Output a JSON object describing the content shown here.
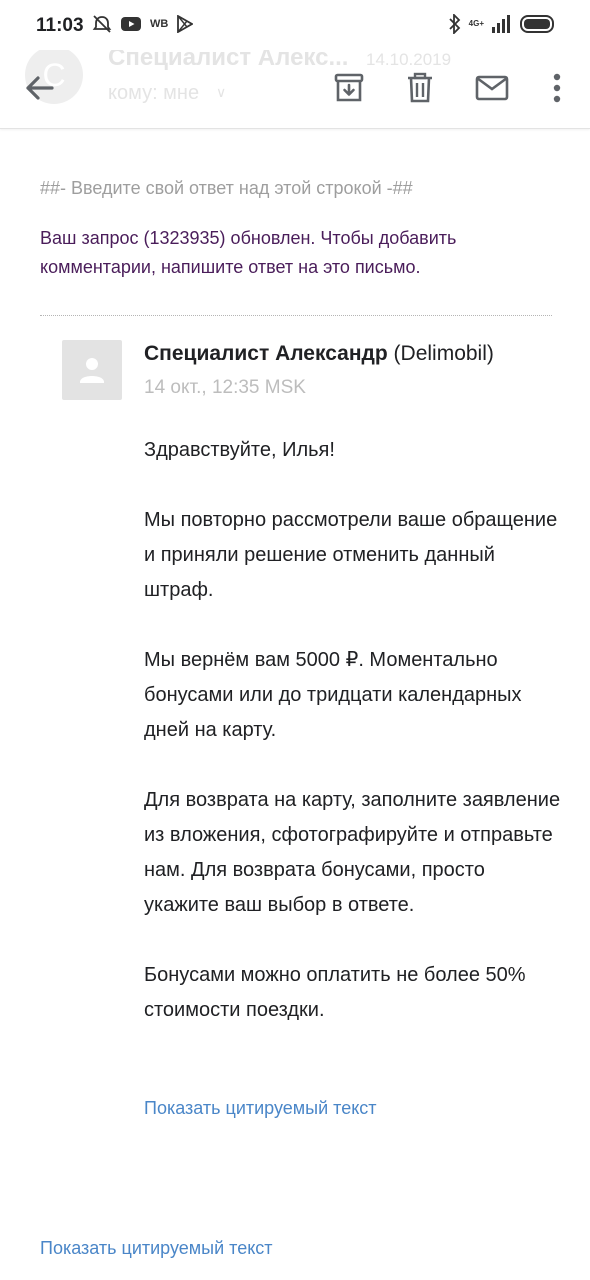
{
  "status_bar": {
    "time": "11:03",
    "carrier_badge": "WB",
    "network": "4G+",
    "icons": [
      "muted-alarm-icon",
      "youtube-icon",
      "play-store-icon",
      "bluetooth-icon",
      "signal-icon",
      "battery-icon"
    ]
  },
  "header": {
    "sender_preview": "Специалист Алекс...",
    "date_preview": "14.10.2019",
    "to_line": "кому: мне",
    "avatar_letter": "С",
    "actions": [
      "back-arrow-icon",
      "archive-icon",
      "delete-icon",
      "mark-unread-icon",
      "more-vert-icon"
    ]
  },
  "email": {
    "reply_hint": "##- Введите свой ответ над этой строкой -##",
    "update_message": "Ваш запрос (1323935) обновлен. Чтобы добавить комментарии, напишите ответ на это письмо.",
    "sender_name": "Специалист Александр",
    "sender_org": "(Delimobil)",
    "sent_time": "14 окт., 12:35 MSK",
    "paragraphs": [
      "Здравствуйте, Илья!",
      "Мы повторно рассмотрели ваше обращение и приняли решение отменить данный штраф.",
      "Мы вернём вам 5000 ₽. Моментально бонусами или до тридцати календарных дней на карту.",
      "Для возврата на карту, заполните заявление из вложения, сфотографируйте и отправьте нам. Для возврата бонусами, просто укажите ваш выбор в ответе.",
      "Бонусами можно оплатить не более 50% стоимости поездки."
    ],
    "show_quoted_inner": "Показать цитируемый текст",
    "show_quoted_outer": "Показать цитируемый текст"
  },
  "colors": {
    "link": "#4a86c8",
    "update_text": "#4a1d5a",
    "hint_text": "#9e9e9e",
    "icon": "#5f6368"
  }
}
